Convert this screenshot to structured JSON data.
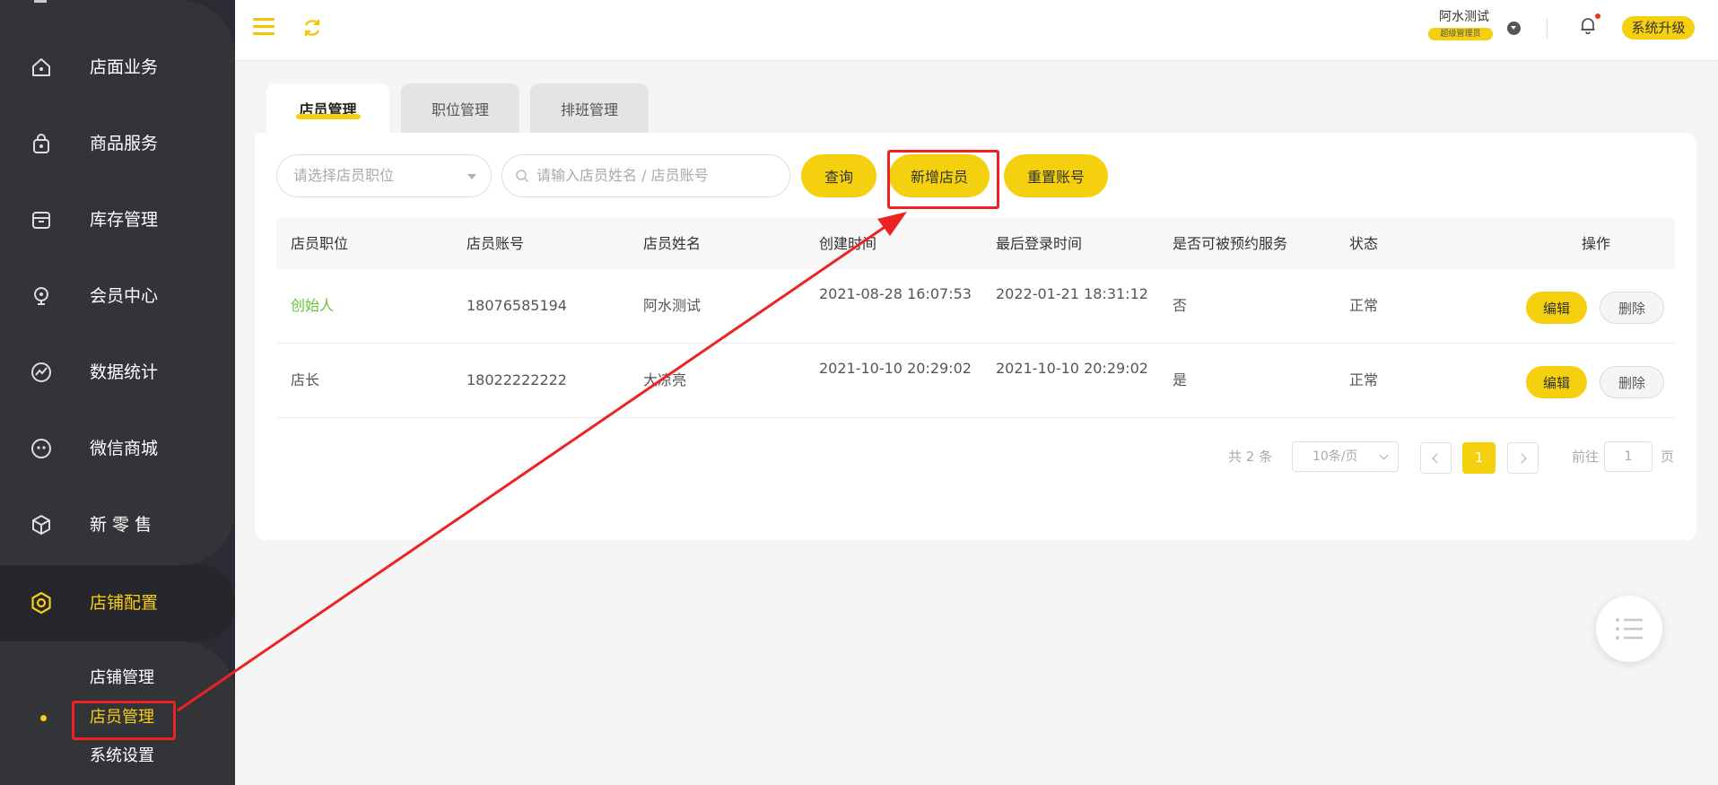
{
  "sidebar": {
    "items": [
      {
        "label": "店面业务",
        "icon": "house-icon"
      },
      {
        "label": "商品服务",
        "icon": "bag-icon"
      },
      {
        "label": "库存管理",
        "icon": "box-icon"
      },
      {
        "label": "会员中心",
        "icon": "member-icon"
      },
      {
        "label": "数据统计",
        "icon": "chart-icon"
      },
      {
        "label": "微信商城",
        "icon": "wechat-icon"
      },
      {
        "label": "新 零 售",
        "icon": "cube-icon"
      },
      {
        "label": "店铺配置",
        "icon": "settings-icon"
      }
    ],
    "subitems": [
      {
        "label": "店铺管理"
      },
      {
        "label": "店员管理"
      },
      {
        "label": "系统设置"
      }
    ]
  },
  "header": {
    "username": "阿水测试",
    "role": "超级管理员",
    "upgrade_label": "系统升级"
  },
  "tabs": [
    {
      "label": "店员管理"
    },
    {
      "label": "职位管理"
    },
    {
      "label": "排班管理"
    }
  ],
  "filters": {
    "position_placeholder": "请选择店员职位",
    "search_placeholder": "请输入店员姓名 / 店员账号",
    "query_label": "查询",
    "add_label": "新增店员",
    "reset_label": "重置账号"
  },
  "table": {
    "columns": [
      "店员职位",
      "店员账号",
      "店员姓名",
      "创建时间",
      "最后登录时间",
      "是否可被预约服务",
      "状态",
      "操作"
    ],
    "rows": [
      {
        "position": "创始人",
        "account": "18076585194",
        "name": "阿水测试",
        "created": "2021-08-28 16:07:53",
        "last_login": "2022-01-21 18:31:12",
        "bookable": "否",
        "status": "正常"
      },
      {
        "position": "店长",
        "account": "18022222222",
        "name": "大凉亮",
        "created": "2021-10-10 20:29:02",
        "last_login": "2021-10-10 20:29:02",
        "bookable": "是",
        "status": "正常"
      }
    ],
    "edit_label": "编辑",
    "delete_label": "删除"
  },
  "pagination": {
    "total_text": "共 2 条",
    "page_size": "10条/页",
    "current_page": "1",
    "goto_label": "前往",
    "goto_value": "1",
    "page_suffix": "页"
  },
  "colors": {
    "accent": "#f5d00f",
    "sidebar_bg": "#2b2c33",
    "annotation": "#ec2323",
    "founder_text": "#67c23a"
  }
}
